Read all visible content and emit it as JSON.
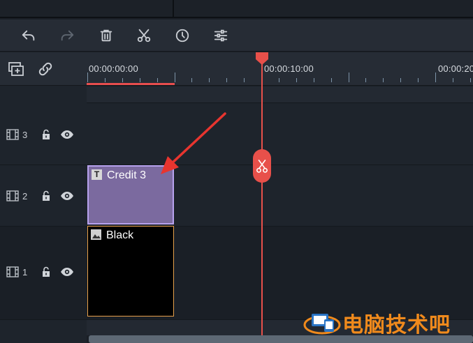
{
  "toolbar": {
    "icons": [
      "undo-icon",
      "redo-icon",
      "delete-icon",
      "cut-icon",
      "speed-icon",
      "adjust-icon"
    ]
  },
  "track_header": {
    "icons": [
      "add-track-icon",
      "link-icon"
    ]
  },
  "ruler": {
    "timecodes": [
      "00:00:00:00",
      "00:00:10:00",
      "00:00:20"
    ]
  },
  "tracks": [
    {
      "number": "3"
    },
    {
      "number": "2"
    },
    {
      "number": "1"
    }
  ],
  "clips": {
    "title_clip": {
      "label": "Credit 3",
      "icon": "T"
    },
    "image_clip": {
      "label": "Black"
    }
  },
  "watermark": {
    "text": "电脑技术吧"
  },
  "colors": {
    "accent": "#e8504a",
    "title_clip": "#7b6a9f",
    "title_clip_border": "#b7a2ee",
    "image_clip_border": "#e7a04a",
    "watermark": "#f08a1c"
  }
}
